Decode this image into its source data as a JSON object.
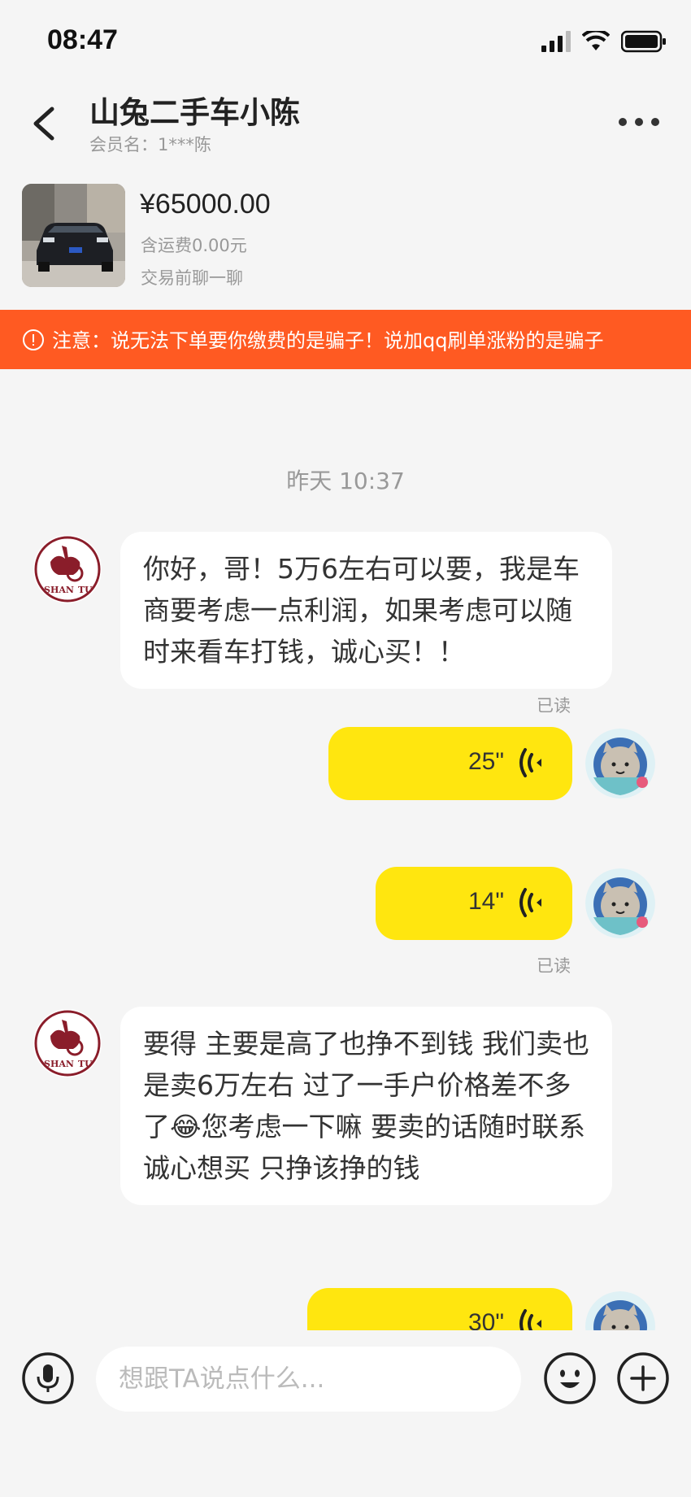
{
  "status": {
    "time": "08:47"
  },
  "header": {
    "title": "山兔二手车小陈",
    "subtitle": "会员名：1***陈"
  },
  "product": {
    "price": "¥65000.00",
    "shipping": "含运费0.00元",
    "hint": "交易前聊一聊"
  },
  "warning": {
    "text": "注意：说无法下单要你缴费的是骗子！说加qq刷单涨粉的是骗子"
  },
  "chat": {
    "timestamp": "昨天 10:37",
    "messages": [
      {
        "type": "text",
        "from": "seller",
        "text": "你好，哥！5万6左右可以要，我是车商要考虑一点利润，如果考虑可以随时来看车打钱，诚心买！！"
      },
      {
        "type": "voice",
        "from": "me",
        "duration": "25\"",
        "status": "已读"
      },
      {
        "type": "voice",
        "from": "me",
        "duration": "14\"",
        "status": "已读"
      },
      {
        "type": "text",
        "from": "seller",
        "text": "要得 主要是高了也挣不到钱 我们卖也是卖6万左右 过了一手户价格差不多了😂您考虑一下嘛 要卖的话随时联系 诚心想买 只挣该挣的钱"
      },
      {
        "type": "voice",
        "from": "me",
        "duration": "30\""
      }
    ]
  },
  "input": {
    "placeholder": "想跟TA说点什么..."
  },
  "colors": {
    "accent": "#ffe60f",
    "warning": "#ff5a22",
    "background": "#f5f5f5"
  }
}
